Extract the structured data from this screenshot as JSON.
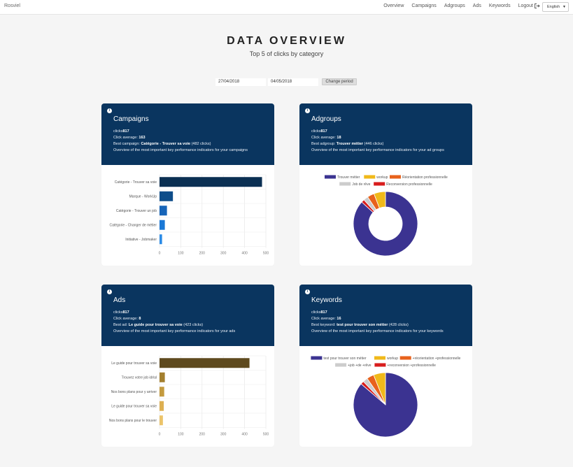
{
  "nav": {
    "brand": "Rosviel",
    "links": [
      "Overview",
      "Campaigns",
      "Adgroups",
      "Ads",
      "Keywords",
      "Logout"
    ],
    "language": "English"
  },
  "hero": {
    "title": "DATA OVERVIEW",
    "subtitle": "Top 5 of clicks by category"
  },
  "period": {
    "start": "27/04/2018",
    "end": "04/05/2018",
    "button": "Change period"
  },
  "cards": {
    "campaigns": {
      "title": "Campaigns",
      "clicks_label": "clicks",
      "clicks": "817",
      "average_label": "Click average:",
      "average": "163",
      "best_label": "Best campaign:",
      "best": "Catégorie - Trouver sa voie",
      "best_clicks": "(482 clicks)",
      "description": "Overview of the most important key performance indicators for your campaigns"
    },
    "adgroups": {
      "title": "Adgroups",
      "clicks_label": "clicks",
      "clicks": "817",
      "average_label": "Click average:",
      "average": "18",
      "best_label": "Best adgroup:",
      "best": "Trouver métier",
      "best_clicks": "(446 clicks)",
      "description": "Overview of the most important key performance indicators for your ad groups"
    },
    "ads": {
      "title": "Ads",
      "clicks_label": "clicks",
      "clicks": "817",
      "average_label": "Click average:",
      "average": "8",
      "best_label": "Best ad:",
      "best": "Le guide pour trouver sa voie",
      "best_clicks": "(423 clicks)",
      "description": "Overview of the most important key performance indicators for your ads"
    },
    "keywords": {
      "title": "Keywords",
      "clicks_label": "clicks",
      "clicks": "817",
      "average_label": "Click average:",
      "average": "16",
      "best_label": "Best keyword:",
      "best": "test pour trouver son métier",
      "best_clicks": "(428 clicks)",
      "description": "Overview of the most important key performance indicators for your keywords"
    }
  },
  "chart_data": [
    {
      "type": "bar",
      "orientation": "horizontal",
      "categories": [
        "Catégorie - Trouver sa voie",
        "Marque - WorkUp",
        "Catégorie - Trouver un job",
        "Catégorie - Changer de métier",
        "Initiative - Jobmaker"
      ],
      "values": [
        482,
        63,
        35,
        25,
        12
      ],
      "colors": [
        "#0a2f52",
        "#0e4d8a",
        "#1664b8",
        "#1a78d6",
        "#2b8be6"
      ],
      "xlim": [
        0,
        500
      ],
      "xticks": [
        0,
        100,
        200,
        300,
        400,
        500
      ],
      "grid": true
    },
    {
      "type": "pie",
      "donut": true,
      "categories": [
        "Trouver métier",
        "workup",
        "Réorientation professionnelle",
        "Job de rêve",
        "Reconversion professionnelle"
      ],
      "values": [
        446,
        30,
        18,
        12,
        8
      ],
      "colors": [
        "#3b3391",
        "#f0b91a",
        "#e8621c",
        "#cccccc",
        "#d81d1d"
      ],
      "legend": "top"
    },
    {
      "type": "bar",
      "orientation": "horizontal",
      "categories": [
        "Le guide pour trouver sa voie",
        "Trouvez votre job idéal",
        "Nos bons plans pour y arriver",
        "Le guide pour trouver sa voie",
        "Nos bons plans pour le trouver"
      ],
      "values": [
        423,
        25,
        22,
        20,
        16
      ],
      "colors": [
        "#5e4a1e",
        "#a37f2e",
        "#c49a3e",
        "#ddb052",
        "#ecc46a"
      ],
      "xlim": [
        0,
        500
      ],
      "xticks": [
        0,
        100,
        200,
        300,
        400,
        500
      ],
      "grid": true
    },
    {
      "type": "pie",
      "donut": false,
      "categories": [
        "test pour trouver son métier",
        "workup",
        "+réorientation +professionnelle",
        "+job +de +rêve",
        "+reconversion +professionnelle"
      ],
      "values": [
        428,
        30,
        18,
        12,
        8
      ],
      "colors": [
        "#3b3391",
        "#f0b91a",
        "#e8621c",
        "#cccccc",
        "#d81d1d"
      ],
      "legend": "top"
    }
  ]
}
